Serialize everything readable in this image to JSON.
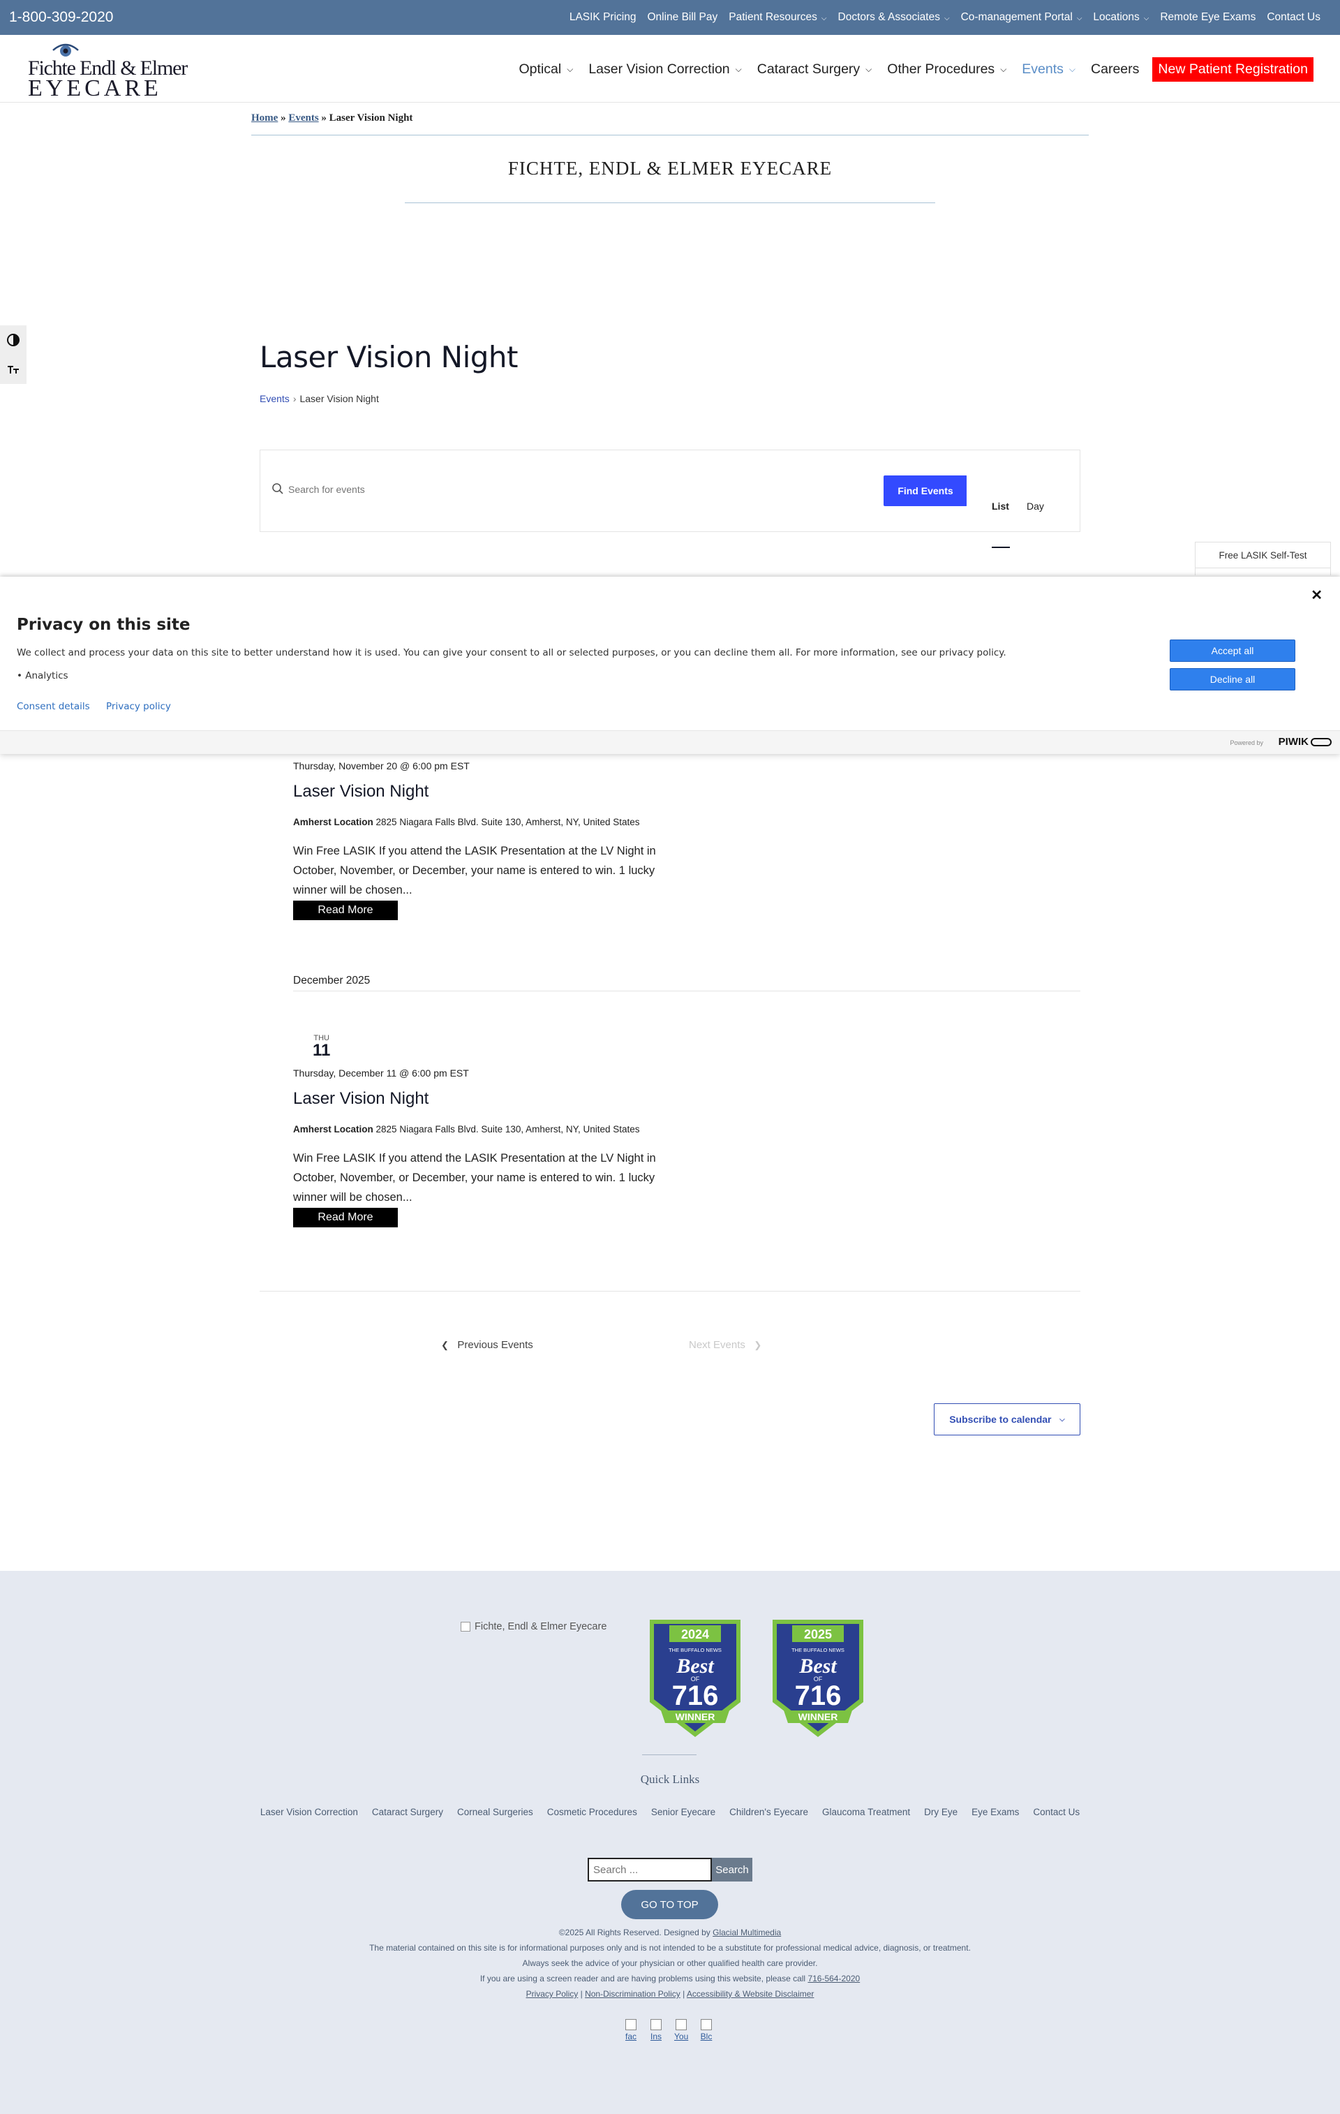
{
  "topbar": {
    "phone": "1-800-309-2020",
    "links": [
      {
        "label": "LASIK Pricing",
        "dropdown": false
      },
      {
        "label": "Online Bill Pay",
        "dropdown": false
      },
      {
        "label": "Patient Resources",
        "dropdown": true
      },
      {
        "label": "Doctors & Associates",
        "dropdown": true
      },
      {
        "label": "Co-management Portal",
        "dropdown": true
      },
      {
        "label": "Locations",
        "dropdown": true
      },
      {
        "label": "Remote Eye Exams",
        "dropdown": false
      },
      {
        "label": "Contact Us",
        "dropdown": false
      }
    ]
  },
  "header": {
    "logo_line1": "Fichte Endl & Elmer",
    "logo_line2": "EYECARE",
    "nav": [
      {
        "label": "Optical",
        "dropdown": true
      },
      {
        "label": "Laser Vision Correction",
        "dropdown": true
      },
      {
        "label": "Cataract Surgery",
        "dropdown": true
      },
      {
        "label": "Other Procedures",
        "dropdown": true
      },
      {
        "label": "Events",
        "dropdown": true,
        "active": true
      },
      {
        "label": "Careers",
        "dropdown": false
      }
    ],
    "cta": "New Patient Registration"
  },
  "breadcrumb": {
    "home": "Home",
    "sep": "»",
    "events": "Events",
    "current": "Laser Vision Night"
  },
  "site_title": "FICHTE, ENDL & ELMER EYECARE",
  "page": {
    "title": "Laser Vision Night",
    "crumb_events": "Events",
    "crumb_sep": "›",
    "crumb_current": "Laser Vision Night"
  },
  "search": {
    "placeholder": "Search for events",
    "button": "Find Events",
    "view_list": "List",
    "view_day": "Day"
  },
  "free_test": "Free LASIK Self-Test",
  "privacy": {
    "title": "Privacy on this site",
    "text": "We collect and process your data on this site to better understand how it is used. You can give your consent to all or selected purposes, or you can decline them all. For more information, see our privacy policy.",
    "bullet": "• Analytics",
    "consent_details": "Consent details",
    "privacy_policy": "Privacy policy",
    "accept": "Accept all",
    "decline": "Decline all",
    "powered_by": "Powered by",
    "brand": "PIWIK"
  },
  "events": [
    {
      "date": "Thursday, November 20 @ 6:00 pm EST",
      "title": "Laser Vision Night",
      "venue_name": "Amherst Location",
      "venue_addr": "2825 Niagara Falls Blvd. Suite 130, Amherst, NY, United States",
      "desc": "Win Free LASIK If you attend the LASIK Presentation at the LV Night in October, November, or December, your name is entered to win. 1 lucky winner will be chosen...",
      "more": "Read More"
    },
    {
      "dow": "THU",
      "day": "11",
      "date": "Thursday, December 11 @ 6:00 pm EST",
      "title": "Laser Vision Night",
      "venue_name": "Amherst Location",
      "venue_addr": "2825 Niagara Falls Blvd. Suite 130, Amherst, NY, United States",
      "desc": "Win Free LASIK If you attend the LASIK Presentation at the LV Night in October, November, or December, your name is entered to win. 1 lucky winner will be chosen...",
      "more": "Read More"
    }
  ],
  "month_sep": "December 2025",
  "pager": {
    "prev": "Previous Events",
    "next": "Next Events"
  },
  "subscribe": "Subscribe to calendar",
  "footer": {
    "logo_alt": "Fichte, Endl & Elmer Eyecare",
    "badges": [
      {
        "year": "2024",
        "top": "THE BUFFALO NEWS",
        "best": "Best",
        "of": "OF",
        "num": "716",
        "winner": "WINNER"
      },
      {
        "year": "2025",
        "top": "THE BUFFALO NEWS",
        "best": "Best",
        "of": "OF",
        "num": "716",
        "winner": "WINNER"
      }
    ],
    "quick_links_title": "Quick Links",
    "quick_links": [
      "Laser Vision Correction",
      "Cataract Surgery",
      "Corneal Surgeries",
      "Cosmetic Procedures",
      "Senior Eyecare",
      "Children's Eyecare",
      "Glaucoma Treatment",
      "Dry Eye",
      "Eye Exams",
      "Contact Us"
    ],
    "search_placeholder": "Search ...",
    "search_button": "Search",
    "gotop": "GO TO TOP",
    "copyright": "©2025 All Rights Reserved. Designed by",
    "designer": "Glacial Multimedia",
    "disclaimer1": "The material contained on this site is for informational purposes only and is not intended to be a substitute for professional medical advice, diagnosis, or treatment.",
    "disclaimer2": "Always seek the advice of your physician or other qualified health care provider.",
    "reader_text": "If you are using a screen reader and are having problems using this website, please call",
    "reader_phone": "716-564-2020",
    "policy1": "Privacy Policy",
    "policy2": "Non-Discrimination Policy",
    "policy3": "Accessibility & Website Disclaimer",
    "policy_sep": "|",
    "social": [
      "fac",
      "Ins",
      "You",
      "Blc"
    ]
  }
}
